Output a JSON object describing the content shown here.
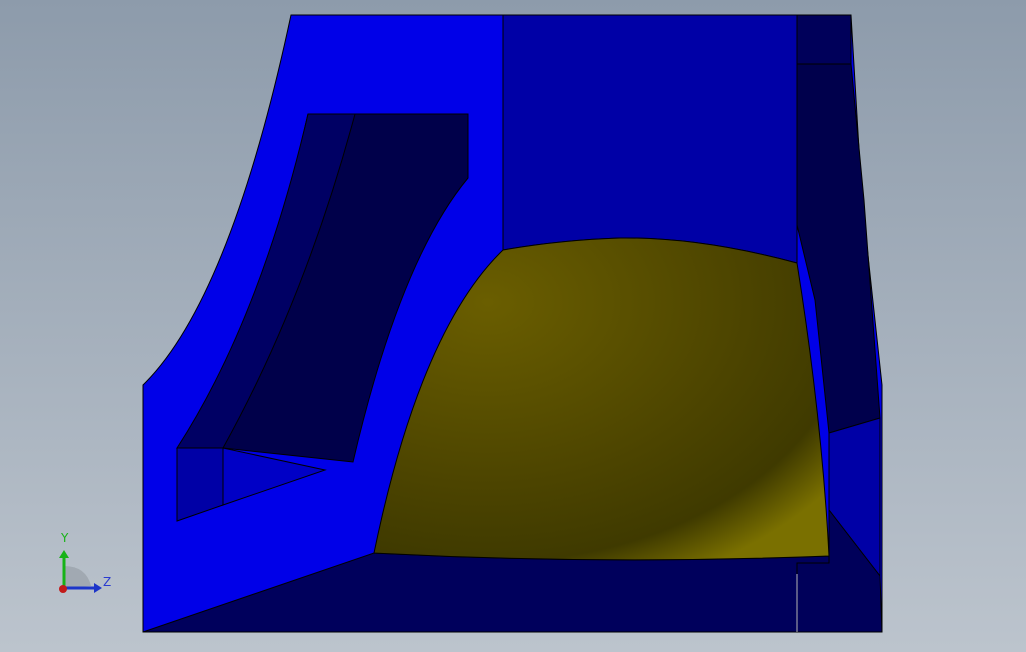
{
  "viewport": {
    "background_top": "#8d9bab",
    "background_bottom": "#bcc4cd"
  },
  "model": {
    "colors": {
      "face_bright": "#0000e8",
      "face_mid": "#0000a6",
      "face_dark": "#00005a",
      "face_darker": "#000048",
      "selected_face_light": "#6a5e00",
      "selected_face_dark": "#474000",
      "edge": "#000000"
    }
  },
  "triad": {
    "y_label": "Y",
    "z_label": "Z",
    "y_color": "#17b317",
    "z_color": "#1c35c9",
    "x_color": "#c21a1a",
    "label_color": "#2a3bd0"
  }
}
